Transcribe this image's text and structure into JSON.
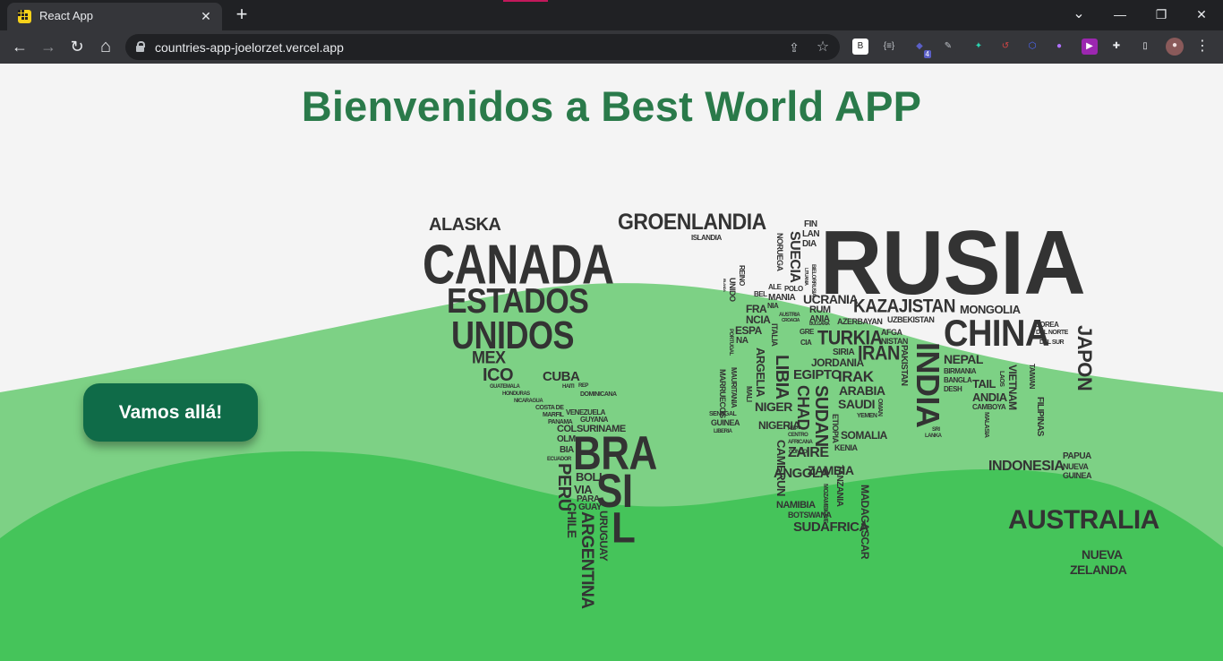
{
  "browser": {
    "tab_title": "React App",
    "tab_close": "✕",
    "new_tab": "+",
    "url": "countries-app-joelorzet.vercel.app",
    "nav": {
      "back": "←",
      "forward": "→",
      "reload": "↻",
      "home": "⌂"
    },
    "window_controls": {
      "minimize": "—",
      "maximize": "❐",
      "close": "✕",
      "tab_search": "⌄"
    },
    "omnibox_icons": {
      "share": "⇪",
      "bookmark": "☆"
    },
    "extensions": [
      {
        "name": "b-extension-icon",
        "label": "B",
        "color": "#ffffff",
        "text_color": "#222222"
      },
      {
        "name": "brackets-extension-icon",
        "label": "{≡}",
        "color": "#35363a",
        "text_color": "#bdc1c6"
      },
      {
        "name": "cube-extension-icon",
        "label": "◆",
        "color": "#35363a",
        "text_color": "#5b5fc7",
        "badge": "4"
      },
      {
        "name": "pen-extension-icon",
        "label": "✎",
        "color": "#35363a",
        "text_color": "#bdc1c6"
      },
      {
        "name": "figure-extension-icon",
        "label": "✦",
        "color": "#35363a",
        "text_color": "#2bd3b0"
      },
      {
        "name": "refresh-extension-icon",
        "label": "↺",
        "color": "#35363a",
        "text_color": "#d64545"
      },
      {
        "name": "hex-extension-icon",
        "label": "⬡",
        "color": "#35363a",
        "text_color": "#4f6bff"
      },
      {
        "name": "gradient-extension-icon",
        "label": "●",
        "color": "#35363a",
        "text_color": "#b070ff"
      },
      {
        "name": "video-extension-icon",
        "label": "▶",
        "color": "#9c27b0",
        "text_color": "#ffffff"
      },
      {
        "name": "puzzle-extension-icon",
        "label": "✚",
        "color": "#35363a",
        "text_color": "#e8eaed"
      },
      {
        "name": "sidepanel-extension-icon",
        "label": "▯",
        "color": "#35363a",
        "text_color": "#e8eaed"
      },
      {
        "name": "profile-avatar-icon",
        "label": "●",
        "color": "#8a5a5a",
        "text_color": "#f0e0e0"
      },
      {
        "name": "menu-kebab-icon",
        "label": "⋮",
        "color": "#35363a",
        "text_color": "#e8eaed"
      }
    ]
  },
  "page": {
    "title": "Bienvenidos a Best World APP",
    "cta_label": "Vamos allá!",
    "colors": {
      "title": "#2a7a4a",
      "button": "#0f6b48",
      "wave_light": "#7dd185",
      "wave_dark": "#45c45a",
      "background": "#f4f4f4"
    }
  },
  "world_map_words": [
    "ALASKA",
    "CANADA",
    "ESTADOS",
    "UNIDOS",
    "MEX",
    "ICO",
    "CUBA",
    "HAITI",
    "REP",
    "DOMINICANA",
    "GUATEMALA",
    "HONDURAS",
    "NICARAGUA",
    "COSTA DE",
    "MARFIL",
    "PANAMA",
    "VENEZUELA",
    "GUYANA",
    "SURINAME",
    "COL",
    "OLM",
    "BIA",
    "ECUADOR",
    "PERU",
    "BRA",
    "SI",
    "L",
    "BOLI",
    "VIA",
    "PARA",
    "GUAY",
    "URUGUAY",
    "CHILE",
    "ARGENTINA",
    "GROENLANDIA",
    "ISLANDIA",
    "RUSIA",
    "FIN",
    "LAN",
    "DIA",
    "SUECIA",
    "NORUEGA",
    "REINO",
    "UNIDO",
    "IRLANDA",
    "ALE",
    "POLO",
    "BEL",
    "MANIA",
    "NIA",
    "FRA",
    "NCIA",
    "ESPA",
    "NA",
    "PORTUGAL",
    "ITALIA",
    "AUSTRIA",
    "GRE",
    "CIA",
    "UCRANIA",
    "BIELORRUSIA",
    "LITUANIA",
    "RUM",
    "ANIA",
    "BULGARIA",
    "CROACIA",
    "KAZAJISTAN",
    "MONGOLIA",
    "AZERBAYAN",
    "UZBEKISTAN",
    "TURKIA",
    "AFGA",
    "NISTAN",
    "CHINA",
    "COREA",
    "DEL NORTE",
    "DEL SUR",
    "JAPON",
    "SIRIA",
    "IRAN",
    "PAKISTAN",
    "INDIA",
    "NEPAL",
    "BIRMANIA",
    "BANGLA",
    "DESH",
    "TAIL",
    "ANDIA",
    "LAOS",
    "VIETNAM",
    "TAIWAN",
    "CAMBOYA",
    "FILIPINAS",
    "MALASIA",
    "JORDANIA",
    "IRAK",
    "ARABIA",
    "SAUDI",
    "YEMEN",
    "OMAN",
    "EGIPTO",
    "LIBIA",
    "ARGELIA",
    "MARRUECOS",
    "MAURITANIA",
    "MALI",
    "SENEGAL",
    "GUINEA",
    "LIBERIA",
    "NIGER",
    "NIGERIA",
    "CHAD",
    "SUDAN",
    "ETIOPIA",
    "SOMALIA",
    "KENIA",
    "CAMERUN",
    "REP",
    "CENTRO",
    "AFRICANA",
    "CONGO",
    "ZAIRE",
    "ANGOLA",
    "ZAMBIA",
    "NAMIBIA",
    "BOTSWANA",
    "SUDAFRICA",
    "TANZANIA",
    "MOZAMBIQUE",
    "MADAGASCAR",
    "INDONESIA",
    "PAPUA",
    "NUEVA",
    "GUINEA",
    "AUSTRALIA",
    "NUEVA",
    "ZELANDA",
    "SRI",
    "LANKA"
  ]
}
